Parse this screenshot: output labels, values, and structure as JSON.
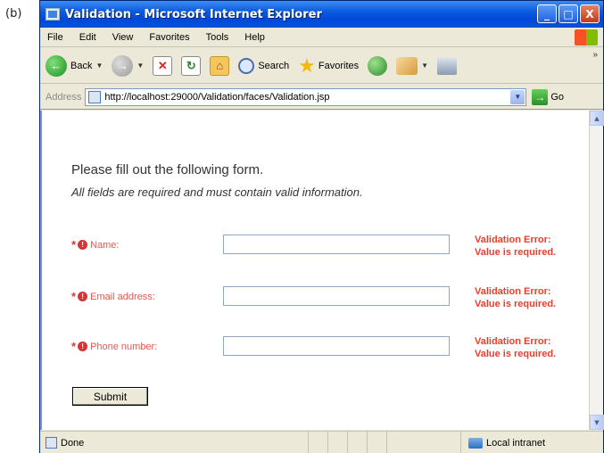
{
  "figure_label": "(b)",
  "window": {
    "title": "Validation - Microsoft Internet Explorer",
    "controls": {
      "minimize": "_",
      "maximize": "□",
      "close": "X"
    }
  },
  "menu": [
    "File",
    "Edit",
    "View",
    "Favorites",
    "Tools",
    "Help"
  ],
  "toolbar": {
    "back_label": "Back",
    "search_label": "Search",
    "favorites_label": "Favorites",
    "more": "»"
  },
  "address": {
    "label": "Address",
    "url": "http://localhost:29000/Validation/faces/Validation.jsp",
    "go_label": "Go"
  },
  "page": {
    "heading": "Please fill out the following form.",
    "subheading": "All fields are required and must contain valid information.",
    "fields": [
      {
        "label": "Name:",
        "value": "",
        "error_line1": "Validation Error:",
        "error_line2": "Value is required."
      },
      {
        "label": "Email address:",
        "value": "",
        "error_line1": "Validation Error:",
        "error_line2": "Value is required."
      },
      {
        "label": "Phone number:",
        "value": "",
        "error_line1": "Validation Error:",
        "error_line2": "Value is required."
      }
    ],
    "required_marker": "*",
    "submit_label": "Submit"
  },
  "status": {
    "text": "Done",
    "zone": "Local intranet"
  },
  "colors": {
    "title_blue": "#0a5be0",
    "error_red": "#e8402e",
    "label_red": "#e05a4e"
  }
}
